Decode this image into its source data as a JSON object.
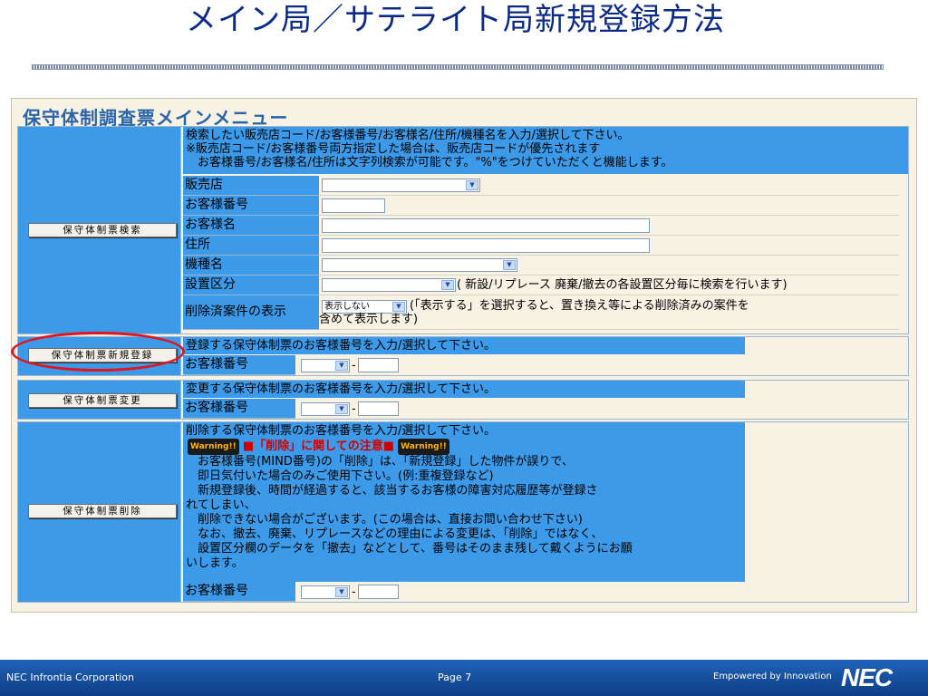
{
  "slide": {
    "title": "メイン局／サテライト局新規登録方法"
  },
  "menu": {
    "title": "保守体制調査票メインメニュー"
  },
  "search": {
    "button": "保守体制票検索",
    "info": [
      "検索したい販売店コード/お客様番号/お客様名/住所/機種名を入力/選択して下さい。",
      "※販売店コード/お客様番号両方指定した場合は、販売店コードが優先されます",
      "　お客様番号/お客様名/住所は文字列検索が可能です。\"%\"をつけていただくと機能します。"
    ],
    "labels": {
      "dealer": "販売店",
      "customer_no": "お客様番号",
      "customer_name": "お客様名",
      "address": "住所",
      "model": "機種名",
      "install_type": "設置区分",
      "deleted_display": "削除済案件の表示"
    },
    "install_type_note": "( 新設/リプレース 廃棄/撤去の各設置区分毎に検索を行います)",
    "deleted_select_value": "表示しない",
    "deleted_note_1": "(「表示する」を選択すると、置き換え等による削除済みの案件を",
    "deleted_note_2": "含めて表示します)"
  },
  "register": {
    "button": "保守体制票新規登録",
    "info": "登録する保守体制票のお客様番号を入力/選択して下さい。",
    "label": "お客様番号"
  },
  "change": {
    "button": "保守体制票変更",
    "info": "変更する保守体制票のお客様番号を入力/選択して下さい。",
    "label": "お客様番号"
  },
  "delete": {
    "button": "保守体制票削除",
    "info": "削除する保守体制票のお客様番号を入力/選択して下さい。",
    "warning_badge": "Warning!!",
    "warning_title": "■「削除」に関しての注意■",
    "lines": [
      "　お客様番号(MIND番号)の「削除」は、「新規登録」した物件が誤りで、",
      "　即日気付いた場合のみご使用下さい。(例:重複登録など)",
      "　新規登録後、時間が経過すると、該当するお客様の障害対応履歴等が登録さ",
      "れてしまい、",
      "　削除できない場合がございます。(この場合は、直接お問い合わせ下さい)",
      "　なお、撤去、廃棄、リプレースなどの理由による変更は、「削除」ではなく、",
      "　設置区分欄のデータを「撤去」などとして、番号はそのまま残して戴くようにお願",
      "いします。"
    ],
    "label": "お客様番号"
  },
  "footer": {
    "company": "NEC Infrontia Corporation",
    "page": "Page 7",
    "tagline": "Empowered by Innovation",
    "logo": "NEC"
  },
  "colors": {
    "title_blue": "#0b2a8a",
    "cell_blue": "#3d9ae8",
    "panel_bg": "#f7f2e4",
    "highlight_red": "#e2141c",
    "footer_blue": "#1f63b8"
  }
}
